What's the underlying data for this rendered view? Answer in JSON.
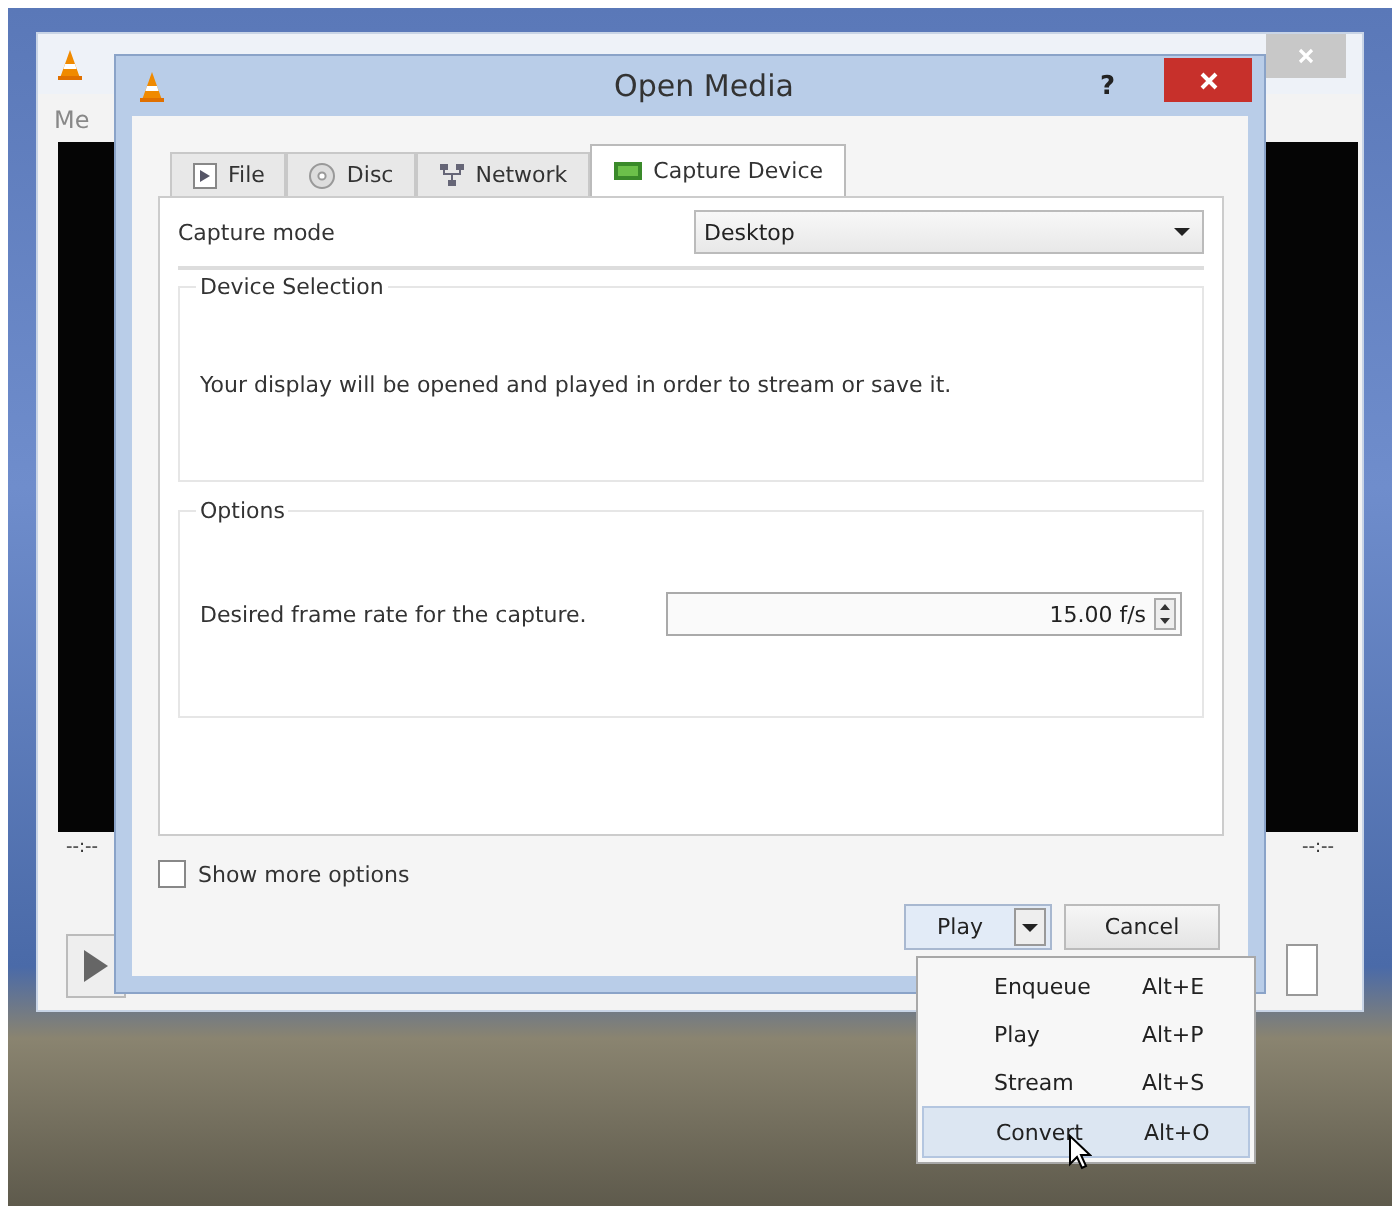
{
  "background_window": {
    "menu": [
      "Me"
    ],
    "time_elapsed": "--:--",
    "time_total": "--:--"
  },
  "dialog": {
    "title": "Open Media",
    "help": "?",
    "tabs": [
      {
        "label": "File",
        "selected": false
      },
      {
        "label": "Disc",
        "selected": false
      },
      {
        "label": "Network",
        "selected": false
      },
      {
        "label": "Capture Device",
        "selected": true
      }
    ],
    "capture_mode": {
      "label": "Capture mode",
      "value": "Desktop"
    },
    "device_selection": {
      "title": "Device Selection",
      "text": "Your display will be opened and played in order to stream or save it."
    },
    "options": {
      "title": "Options",
      "frame_rate": {
        "label": "Desired frame rate for the capture.",
        "value": "15.00 f/s"
      }
    },
    "show_more_options": {
      "label": "Show more options",
      "checked": false
    },
    "buttons": [
      {
        "label": "Play",
        "kind": "split"
      },
      {
        "label": "Cancel",
        "kind": "plain"
      }
    ]
  },
  "dropdown_menu": {
    "items": [
      {
        "label": "Enqueue",
        "shortcut": "Alt+E",
        "selected": false
      },
      {
        "label": "Play",
        "shortcut": "Alt+P",
        "selected": false
      },
      {
        "label": "Stream",
        "shortcut": "Alt+S",
        "selected": false
      },
      {
        "label": "Convert",
        "shortcut": "Alt+O",
        "selected": true
      }
    ]
  }
}
